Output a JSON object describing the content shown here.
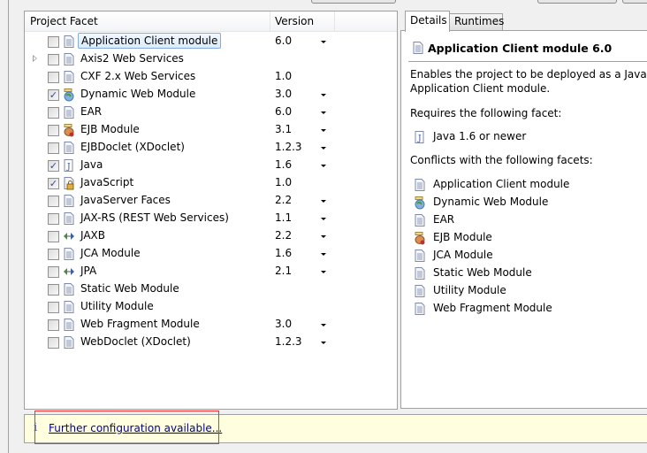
{
  "table": {
    "headers": {
      "facet": "Project Facet",
      "version": "Version"
    },
    "rows": [
      {
        "name": "Application Client module",
        "version": "6.0",
        "checked": false,
        "dropdown": true,
        "icon": "page-icon",
        "selected": true,
        "expandable": false
      },
      {
        "name": "Axis2 Web Services",
        "version": "",
        "checked": false,
        "dropdown": false,
        "icon": "page-icon",
        "selected": false,
        "expandable": true
      },
      {
        "name": "CXF 2.x Web Services",
        "version": "1.0",
        "checked": false,
        "dropdown": false,
        "icon": "page-icon",
        "selected": false,
        "expandable": false
      },
      {
        "name": "Dynamic Web Module",
        "version": "3.0",
        "checked": true,
        "dropdown": true,
        "icon": "globe-icon",
        "selected": false,
        "expandable": false
      },
      {
        "name": "EAR",
        "version": "6.0",
        "checked": false,
        "dropdown": true,
        "icon": "page-icon",
        "selected": false,
        "expandable": false
      },
      {
        "name": "EJB Module",
        "version": "3.1",
        "checked": false,
        "dropdown": true,
        "icon": "bean-icon",
        "selected": false,
        "expandable": false
      },
      {
        "name": "EJBDoclet (XDoclet)",
        "version": "1.2.3",
        "checked": false,
        "dropdown": true,
        "icon": "page-icon",
        "selected": false,
        "expandable": false
      },
      {
        "name": "Java",
        "version": "1.6",
        "checked": true,
        "dropdown": true,
        "icon": "java-icon",
        "selected": false,
        "expandable": false
      },
      {
        "name": "JavaScript",
        "version": "1.0",
        "checked": true,
        "dropdown": false,
        "icon": "lock-page-icon",
        "selected": false,
        "expandable": false
      },
      {
        "name": "JavaServer Faces",
        "version": "2.2",
        "checked": false,
        "dropdown": true,
        "icon": "page-icon",
        "selected": false,
        "expandable": false
      },
      {
        "name": "JAX-RS (REST Web Services)",
        "version": "1.1",
        "checked": false,
        "dropdown": true,
        "icon": "page-icon",
        "selected": false,
        "expandable": false
      },
      {
        "name": "JAXB",
        "version": "2.2",
        "checked": false,
        "dropdown": true,
        "icon": "arrows-icon",
        "selected": false,
        "expandable": false
      },
      {
        "name": "JCA Module",
        "version": "1.6",
        "checked": false,
        "dropdown": true,
        "icon": "page-icon",
        "selected": false,
        "expandable": false
      },
      {
        "name": "JPA",
        "version": "2.1",
        "checked": false,
        "dropdown": true,
        "icon": "arrows-icon",
        "selected": false,
        "expandable": false
      },
      {
        "name": "Static Web Module",
        "version": "",
        "checked": false,
        "dropdown": false,
        "icon": "page-icon",
        "selected": false,
        "expandable": false
      },
      {
        "name": "Utility Module",
        "version": "",
        "checked": false,
        "dropdown": false,
        "icon": "page-icon",
        "selected": false,
        "expandable": false
      },
      {
        "name": "Web Fragment Module",
        "version": "3.0",
        "checked": false,
        "dropdown": true,
        "icon": "page-icon",
        "selected": false,
        "expandable": false
      },
      {
        "name": "WebDoclet (XDoclet)",
        "version": "1.2.3",
        "checked": false,
        "dropdown": true,
        "icon": "page-icon",
        "selected": false,
        "expandable": false
      }
    ]
  },
  "details": {
    "tabs": [
      "Details",
      "Runtimes"
    ],
    "title": "Application Client module 6.0",
    "description_line1": "Enables the project to be deployed as a Java",
    "description_line2": "Application Client module.",
    "requires_label": "Requires the following facet:",
    "requires": [
      {
        "name": "Java 1.6 or newer",
        "icon": "java-icon"
      }
    ],
    "conflicts_label": "Conflicts with the following facets:",
    "conflicts": [
      {
        "name": "Application Client module",
        "icon": "page-icon"
      },
      {
        "name": "Dynamic Web Module",
        "icon": "globe-icon"
      },
      {
        "name": "EAR",
        "icon": "page-icon"
      },
      {
        "name": "EJB Module",
        "icon": "bean-icon"
      },
      {
        "name": "JCA Module",
        "icon": "page-icon"
      },
      {
        "name": "Static Web Module",
        "icon": "page-icon"
      },
      {
        "name": "Utility Module",
        "icon": "page-icon"
      },
      {
        "name": "Web Fragment Module",
        "icon": "page-icon"
      }
    ]
  },
  "info": {
    "link": "Further configuration available..."
  },
  "colors": {
    "link": "#00008b",
    "info_bg": "#ffffe0",
    "highlight": "#ff2a2a"
  }
}
